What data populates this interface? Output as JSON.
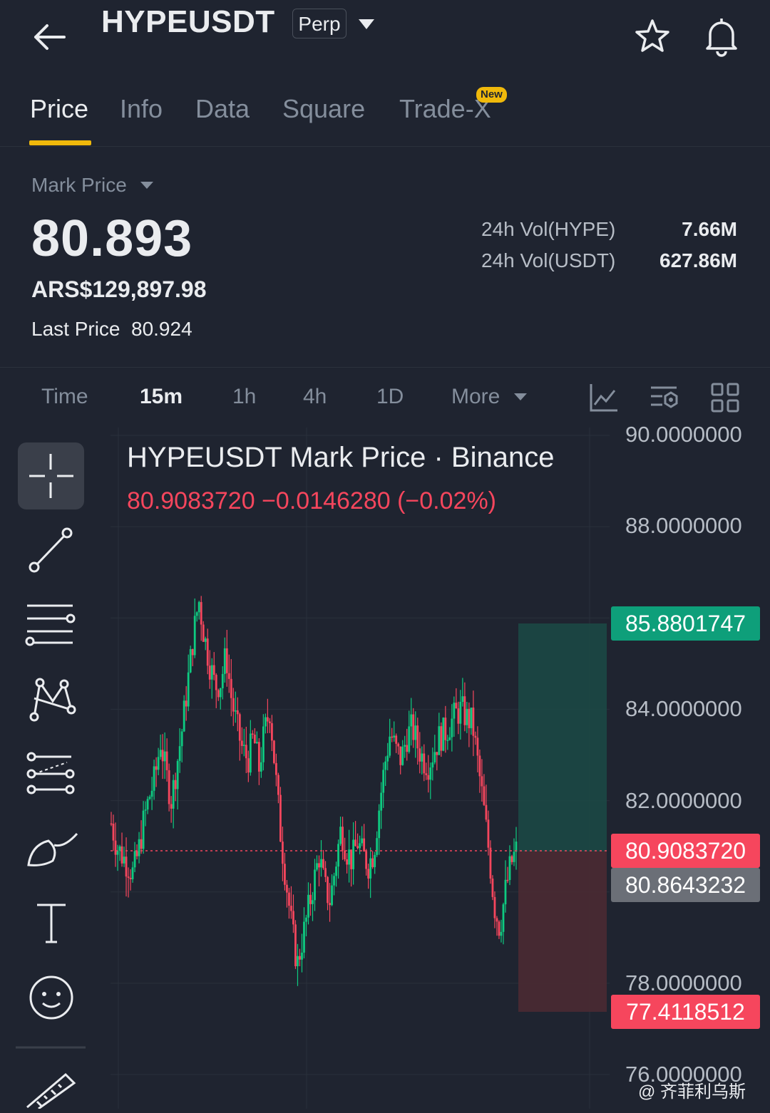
{
  "header": {
    "pair": "HYPEUSDT",
    "contract_type": "Perp"
  },
  "tabs": [
    {
      "label": "Price",
      "active": true
    },
    {
      "label": "Info",
      "active": false
    },
    {
      "label": "Data",
      "active": false
    },
    {
      "label": "Square",
      "active": false
    },
    {
      "label": "Trade-X",
      "active": false,
      "badge": "New"
    }
  ],
  "price": {
    "mark_label": "Mark Price",
    "mark_price": "80.893",
    "fiat_price": "ARS$129,897.98",
    "last_label": "Last Price",
    "last_price": "80.924",
    "vol_hype_label": "24h Vol(HYPE)",
    "vol_hype_value": "7.66M",
    "vol_usdt_label": "24h Vol(USDT)",
    "vol_usdt_value": "627.86M"
  },
  "intervals": {
    "time": "Time",
    "m15": "15m",
    "h1": "1h",
    "h4": "4h",
    "d1": "1D",
    "more": "More",
    "active": "15m"
  },
  "chart": {
    "title": "HYPEUSDT Mark Price · Binance",
    "ohlc": "80.9083720  −0.0146280 (−0.02%)",
    "axis": [
      "90.0000000",
      "88.0000000",
      "84.0000000",
      "82.0000000",
      "78.0000000",
      "76.0000000"
    ],
    "tag_take_profit": "85.8801747",
    "tag_mark": "80.9083720",
    "tag_entry": "80.8643232",
    "tag_stop_loss": "77.4118512",
    "colors": {
      "up": "#0ecb81",
      "down": "#f6465d",
      "accent": "#f0b90b"
    }
  },
  "chart_data": {
    "type": "candlestick",
    "title": "HYPEUSDT Mark Price · Binance",
    "ylim": [
      76,
      90
    ],
    "y_ticks": [
      90,
      88,
      84,
      82,
      78,
      76
    ],
    "close_path": [
      81.5,
      81.0,
      80.8,
      80.6,
      80.4,
      80.9,
      81.6,
      82.1,
      82.5,
      83.3,
      82.6,
      82.0,
      82.8,
      83.6,
      84.6,
      85.6,
      86.4,
      85.6,
      85.0,
      84.5,
      84.6,
      85.2,
      84.2,
      83.6,
      83.1,
      82.9,
      83.4,
      82.7,
      83.5,
      84.0,
      82.6,
      81.2,
      80.2,
      79.2,
      78.4,
      79.0,
      79.6,
      80.2,
      80.8,
      80.1,
      79.8,
      80.6,
      81.4,
      80.9,
      80.7,
      81.1,
      80.8,
      80.6,
      80.9,
      81.9,
      82.8,
      83.5,
      83.1,
      82.9,
      83.4,
      83.6,
      83.2,
      82.9,
      82.8,
      83.1,
      83.4,
      83.5,
      83.7,
      83.9,
      84.0,
      83.8,
      83.7,
      82.8,
      81.9,
      80.9,
      79.7,
      79.2,
      80.0,
      80.6,
      80.9
    ],
    "take_profit": 85.8801747,
    "mark_price": 80.908372,
    "entry": 80.8643232,
    "stop_loss": 77.4118512
  },
  "watermark": "@ 齐菲利乌斯"
}
